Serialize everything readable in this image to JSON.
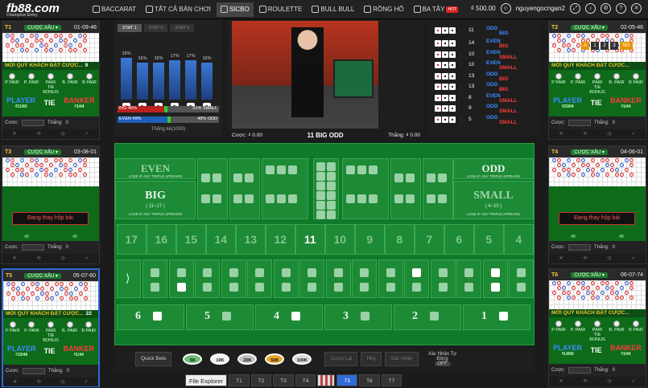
{
  "topbar": {
    "logo": "fb88.com",
    "logo_sub": "Champion Entry",
    "nav": [
      {
        "label": "BACCARAT",
        "icon": "cards-icon"
      },
      {
        "label": "TẤT CẢ BÀN CHƠI",
        "icon": "table-icon"
      },
      {
        "label": "SICBO",
        "icon": "dice-icon",
        "active": true
      },
      {
        "label": "ROULETTE",
        "icon": "roulette-icon"
      },
      {
        "label": "BULL BULL",
        "icon": "bull-icon"
      },
      {
        "label": "RỒNG HỔ",
        "icon": "dragon-icon"
      },
      {
        "label": "BA TÂY",
        "icon": "cards-icon",
        "hot": "HOT"
      }
    ],
    "balance": "₫ 500.00",
    "username": "nguyengocngan2"
  },
  "left_tables": [
    {
      "name": "T1",
      "streak": "CƯỢC XẤU ▾",
      "time": "01-09-46",
      "welcome": "MỜI QUÝ KHÁCH ĐẶT CƯỢC...",
      "count": "9",
      "player": "PLAYER",
      "tie": "TIE",
      "banker": "BANKER",
      "pvals": "₫21/60",
      "bvals": "₫1/44",
      "bet_label": "Cược:",
      "win_label": "Thắng:",
      "bet_value": "",
      "win_value": "0"
    },
    {
      "name": "T3",
      "streak": "CƯỢC XẤU ▾",
      "time": "03-08-01",
      "changing": "Đang thay hộp bài",
      "bet_label": "Cược:",
      "win_label": "Thắng:",
      "bet_value": "",
      "win_value": "0",
      "pvals": "#0",
      "bvals": "#0"
    },
    {
      "name": "T5",
      "streak": "CƯỢC XẤU ▾",
      "time": "05-07-60",
      "welcome": "MỜI QUÝ KHÁCH ĐẶT CƯỢC...",
      "count": "22",
      "player": "PLAYER",
      "tie": "TIE",
      "banker": "BANKER",
      "pvals": "₫15/46",
      "bvals": "₫1/44",
      "bet_label": "Cược:",
      "win_label": "Thắng:",
      "bet_value": "",
      "win_value": "0"
    }
  ],
  "right_tables": [
    {
      "name": "T2",
      "streak": "CƯỢC XẤU ▾",
      "time": "02-05-46",
      "welcome": "MỜI QUÝ KHÁCH ĐẶT CƯỢC...",
      "count": "",
      "player": "PLAYER",
      "tie": "TIE",
      "banker": "BANKER",
      "pvals": "₫25/04",
      "bvals": "₫1/44",
      "bet_label": "Cược:",
      "win_label": "Thắng:",
      "bet_value": "",
      "win_value": "0"
    },
    {
      "name": "T4",
      "streak": "CƯỢC XẤU ▾",
      "time": "04-06-01",
      "changing": "Đang thay hộp bài",
      "bet_label": "Cược:",
      "win_label": "Thắng:",
      "bet_value": "",
      "win_value": "0",
      "pvals": "#0",
      "bvals": "#0"
    },
    {
      "name": "T6",
      "streak": "CƯỢC XẤU ▾",
      "time": "06-07-74",
      "welcome": "MỜI QUÝ KHÁCH ĐẶT CƯỢC...",
      "count": "",
      "player": "PLAYER",
      "tie": "TIE",
      "banker": "BANKER",
      "pvals": "₫14/60",
      "bvals": "₫1/44",
      "bet_label": "Cược:",
      "win_label": "Thắng:",
      "bet_value": "",
      "win_value": "0"
    }
  ],
  "side_bet_labels": [
    "P PAIR",
    "P. PAIR",
    "PAIR TIE BONUS",
    "B. PAIR",
    "B PAIR"
  ],
  "stats": {
    "tabs": [
      "STAT 1",
      "STAT 2",
      "STAT 3"
    ],
    "percents": [
      "18%",
      "16%",
      "16%",
      "17%",
      "17%",
      "16%"
    ],
    "big_label": "BIG",
    "big_pct": "46%",
    "small_pct": "51%",
    "small_label": "SMALL",
    "even_label": "EVEN",
    "even_pct": "49%",
    "odd_pct": "48%",
    "odd_label": "ODD",
    "footer": "Thống kê(1000)"
  },
  "video": {
    "round_nums": [
      "A",
      "1",
      "2",
      "3",
      "NO"
    ],
    "bet_label": "Cược:",
    "bet_value": "₫ 0.00",
    "result": "11 BIG ODD",
    "win_label": "Thắng:",
    "win_value": "₫ 0.00"
  },
  "history": [
    {
      "sum": "11",
      "tags": [
        "ODD",
        "BIG"
      ]
    },
    {
      "sum": "14",
      "tags": [
        "EVEN",
        "BIG"
      ]
    },
    {
      "sum": "10",
      "tags": [
        "EVEN",
        "SMALL"
      ]
    },
    {
      "sum": "10",
      "tags": [
        "EVEN",
        "SMALL"
      ]
    },
    {
      "sum": "13",
      "tags": [
        "ODD",
        "BIG"
      ]
    },
    {
      "sum": "13",
      "tags": [
        "ODD",
        "BIG"
      ]
    },
    {
      "sum": "8",
      "tags": [
        "EVEN",
        "SMALL"
      ]
    },
    {
      "sum": "9",
      "tags": [
        "ODD",
        "SMALL"
      ]
    },
    {
      "sum": "5",
      "tags": [
        "ODD",
        "SMALL"
      ]
    }
  ],
  "board": {
    "even": "EVEN",
    "odd": "ODD",
    "big": "BIG",
    "big_range": "( 11~17 )",
    "small": "SMALL",
    "small_range": "( 4~10 )",
    "lose_note": "LOSE IF ANY TRIPLE APPEARS",
    "totals": [
      "17",
      "16",
      "15",
      "14",
      "13",
      "12",
      "11",
      "10",
      "9",
      "8",
      "7",
      "6",
      "5",
      "4"
    ],
    "singles": [
      "6",
      "5",
      "4",
      "3",
      "2",
      "1"
    ],
    "pay_labels": {
      "single": "1 WINS 1",
      "big": "1 WINS 1",
      "triple": "1 WINS 150"
    }
  },
  "bottom": {
    "quick": "Quick Bets",
    "chips": [
      "5K",
      "10K",
      "20K",
      "50K",
      "100K"
    ],
    "buttons": [
      "Cược Lại",
      "Hủy",
      "Xác nhận"
    ],
    "confirm_label": "Xác Nhận Tự Động",
    "toggle": "OFF"
  },
  "tabs": [
    "File Explorer",
    "T1",
    "T2",
    "T3",
    "T4",
    "",
    "T5",
    "T6",
    "T7"
  ]
}
